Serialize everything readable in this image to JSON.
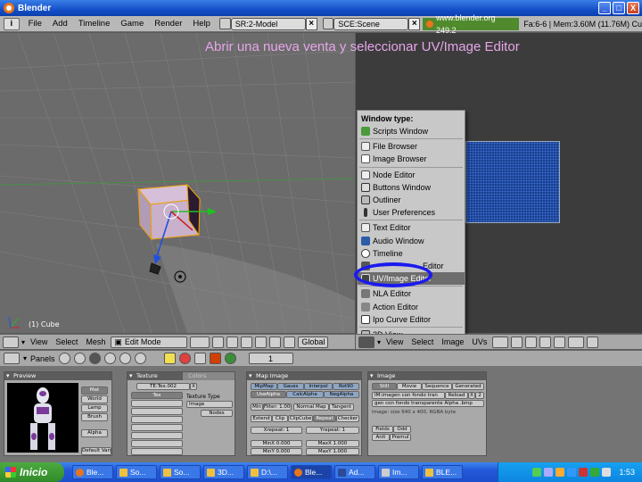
{
  "window": {
    "title": "Blender",
    "buttons": [
      "_",
      "□",
      "X"
    ]
  },
  "topbar": {
    "menus": [
      "File",
      "Add",
      "Timeline",
      "Game",
      "Render",
      "Help"
    ],
    "screen": "SR:2-Model",
    "scene": "SCE:Scene",
    "url": "www.blender.org 249.2",
    "stats": "Fa:6-6 | Mem:3.60M (11.76M) Cu"
  },
  "instruction": "Abrir una nueva venta y seleccionar UV/Image Editor",
  "viewport": {
    "object_label": "(1) Cube"
  },
  "window_type_menu": {
    "title": "Window type:",
    "items": [
      {
        "label": "Scripts Window",
        "icon": "scripts-icon"
      },
      {
        "label": "File Browser",
        "icon": "file-browser-icon"
      },
      {
        "label": "Image Browser",
        "icon": "image-browser-icon"
      },
      {
        "label": "Node Editor",
        "icon": "node-editor-icon"
      },
      {
        "label": "Buttons Window",
        "icon": "buttons-window-icon"
      },
      {
        "label": "Outliner",
        "icon": "outliner-icon"
      },
      {
        "label": "User Preferences",
        "icon": "user-preferences-icon"
      },
      {
        "label": "Text Editor",
        "icon": "text-editor-icon"
      },
      {
        "label": "Audio Window",
        "icon": "audio-window-icon"
      },
      {
        "label": "Timeline",
        "icon": "timeline-icon"
      },
      {
        "label": "Editor",
        "icon": "video-editor-icon"
      },
      {
        "label": "UV/Image Editor",
        "icon": "uv-image-editor-icon",
        "selected": true
      },
      {
        "label": "NLA Editor",
        "icon": "nla-editor-icon"
      },
      {
        "label": "Action Editor",
        "icon": "action-editor-icon"
      },
      {
        "label": "Ipo Curve Editor",
        "icon": "ipo-curve-editor-icon"
      },
      {
        "label": "3D View",
        "icon": "3d-view-icon"
      }
    ]
  },
  "viewport_header": {
    "view": "View",
    "select": "Select",
    "mesh": "Mesh",
    "mode": "Edit Mode",
    "orientation": "Global"
  },
  "image_header": {
    "view": "View",
    "select": "Select",
    "image": "Image",
    "uvs": "UVs"
  },
  "buttons_window": {
    "panels_label": "Panels",
    "frame": "1",
    "preview": {
      "title": "Preview",
      "buttons": [
        "Mat",
        "World",
        "Lamp",
        "Brush",
        "Alpha",
        "Default Vars"
      ]
    },
    "texture": {
      "title": "Texture",
      "tab_colors": "Colors",
      "name": "TE:Tex.002",
      "x": "X",
      "tex": "Tex",
      "type_label": "Texture Type",
      "type_value": "Image",
      "nodes": "Nodes"
    },
    "map_image": {
      "title": "Map Image",
      "row1": [
        "MipMap",
        "Gauss",
        "Interpol",
        "Rot90"
      ],
      "row2": [
        "UseAlpha",
        "CalcAlpha",
        "NegAlpha"
      ],
      "filter": "Min",
      "filter_value": "Filter: 1.000",
      "normal_map": "Normal Map",
      "tangent": "Tangent",
      "row4": [
        "Extend",
        "Clip",
        "ClipCube",
        "Repeat",
        "Checker"
      ],
      "xrepeat": "Xrepeat: 1",
      "yrepeat": "Yrepeat: 1",
      "minx": "MinX 0.000",
      "maxx": "MaxX 1.000",
      "miny": "MinY 0.000",
      "maxy": "MaxY 1.000"
    },
    "image": {
      "title": "Image",
      "tabs": [
        "Still",
        "Movie",
        "Sequence",
        "Generated"
      ],
      "img_name": "IM:imagen con fondo tran",
      "reload": "Reload",
      "x": "X",
      "count": "2",
      "path": "gen con fondo transparente Alpha .bmp",
      "info": "Image: size 640 x 400, RGBA byte",
      "fields": "Fields",
      "odd": "Odd",
      "anti": "Anti",
      "premul": "Premul"
    }
  },
  "taskbar": {
    "start": "Inicio",
    "tasks": [
      "Ble...",
      "So...",
      "So...",
      "3D...",
      "D:\\...",
      "Ble...",
      "Ad...",
      "Im...",
      "BLE..."
    ],
    "active_index": 5,
    "clock": "1:53"
  }
}
